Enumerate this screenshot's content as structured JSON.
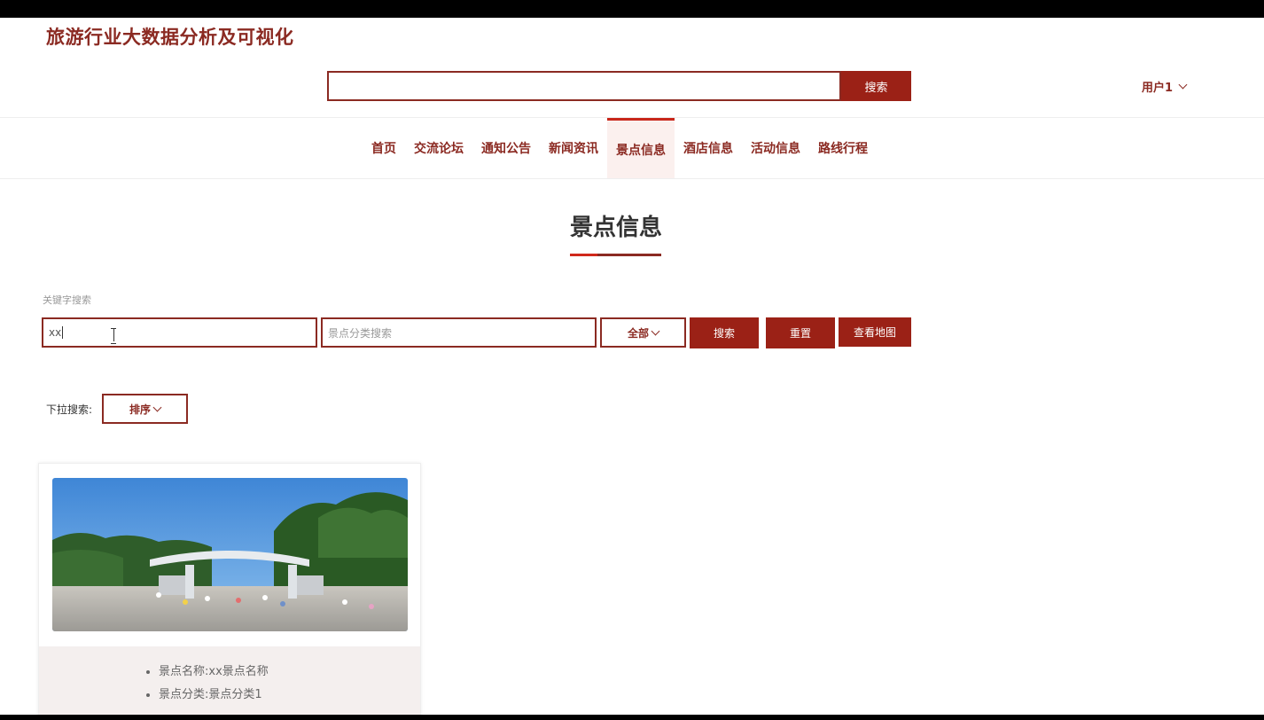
{
  "site": {
    "title": "旅游行业大数据分析及可视化"
  },
  "header": {
    "search_button": "搜索",
    "user_label": "用户1"
  },
  "nav": {
    "items": [
      {
        "label": "首页"
      },
      {
        "label": "交流论坛"
      },
      {
        "label": "通知公告"
      },
      {
        "label": "新闻资讯"
      },
      {
        "label": "景点信息",
        "active": true
      },
      {
        "label": "酒店信息"
      },
      {
        "label": "活动信息"
      },
      {
        "label": "路线行程"
      }
    ]
  },
  "page": {
    "heading": "景点信息"
  },
  "filters": {
    "keyword_label": "关键字搜索",
    "keyword_value": "xx",
    "category_placeholder": "景点分类搜索",
    "select_all": "全部",
    "search_button": "搜索",
    "reset_button": "重置",
    "map_button": "查看地图",
    "dropdown_label": "下拉搜索:",
    "sort_label": "排序"
  },
  "cards": [
    {
      "name_line": "景点名称:xx景点名称",
      "category_line": "景点分类:景点分类1"
    }
  ],
  "colors": {
    "brand": "#8b2a22",
    "button": "#9b2116",
    "accent": "#c8261a"
  }
}
